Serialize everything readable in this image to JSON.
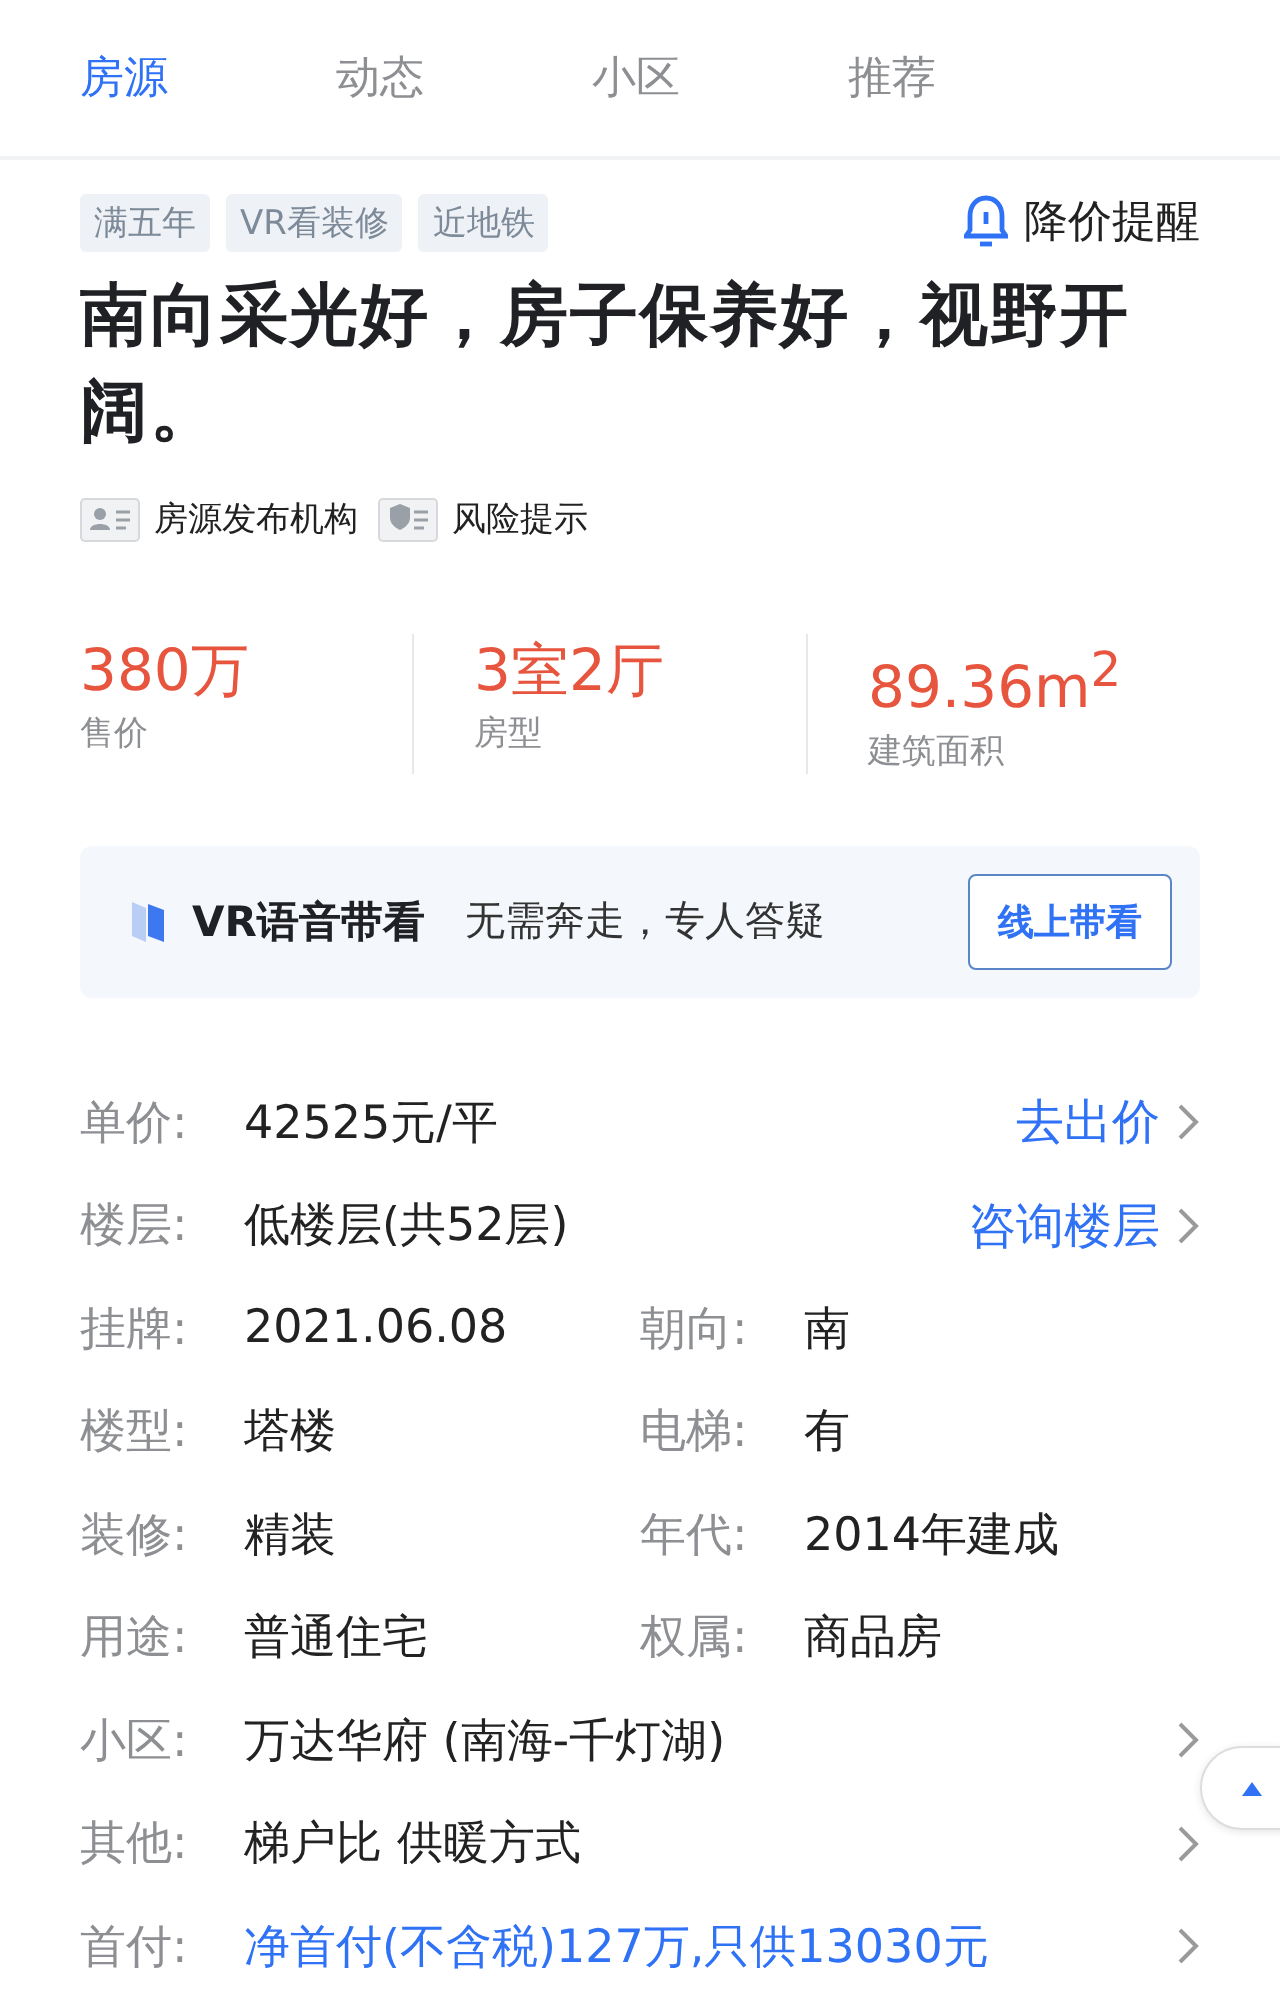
{
  "tabs": [
    {
      "label": "房源",
      "selected": true
    },
    {
      "label": "动态",
      "selected": false
    },
    {
      "label": "小区",
      "selected": false
    },
    {
      "label": "推荐",
      "selected": false
    }
  ],
  "tags": [
    "满五年",
    "VR看装修",
    "近地铁"
  ],
  "price_alert": "降价提醒",
  "title": "南向采光好，房子保养好，视野开阔。",
  "info_links": [
    {
      "kind": "agency",
      "label": "房源发布机构"
    },
    {
      "kind": "risk",
      "label": "风险提示"
    }
  ],
  "stats": [
    {
      "value": "380万",
      "label": "售价"
    },
    {
      "value": "3室2厅",
      "label": "房型"
    },
    {
      "value": "89.36m$^{2}$",
      "label": "建筑面积"
    }
  ],
  "vr_banner": {
    "title": "VR语音带看",
    "subtitle": "无需奔走，专人答疑",
    "button": "线上带看"
  },
  "details": [
    {
      "kind": "single",
      "label": "单价:",
      "value": "42525元/平",
      "action": "去出价",
      "chevron": true,
      "link": false
    },
    {
      "kind": "single",
      "label": "楼层:",
      "value": "低楼层(共52层)",
      "action": "咨询楼层",
      "chevron": true,
      "link": false
    },
    {
      "kind": "pair",
      "items": [
        {
          "label": "挂牌:",
          "value": "2021.06.08"
        },
        {
          "label": "朝向:",
          "value": "南"
        }
      ]
    },
    {
      "kind": "pair",
      "items": [
        {
          "label": "楼型:",
          "value": "塔楼"
        },
        {
          "label": "电梯:",
          "value": "有"
        }
      ]
    },
    {
      "kind": "pair",
      "items": [
        {
          "label": "装修:",
          "value": "精装"
        },
        {
          "label": "年代:",
          "value": "2014年建成"
        }
      ]
    },
    {
      "kind": "pair",
      "items": [
        {
          "label": "用途:",
          "value": "普通住宅"
        },
        {
          "label": "权属:",
          "value": "商品房"
        }
      ]
    },
    {
      "kind": "single",
      "label": "小区:",
      "value": "万达华府 (南海-千灯湖)",
      "chevron": true,
      "link": false
    },
    {
      "kind": "single",
      "label": "其他:",
      "value": "梯户比 供暖方式",
      "chevron": true,
      "link": false
    },
    {
      "kind": "single",
      "label": "首付:",
      "value": "净首付(不含税)127万,只供13030元",
      "chevron": true,
      "link": true
    }
  ]
}
